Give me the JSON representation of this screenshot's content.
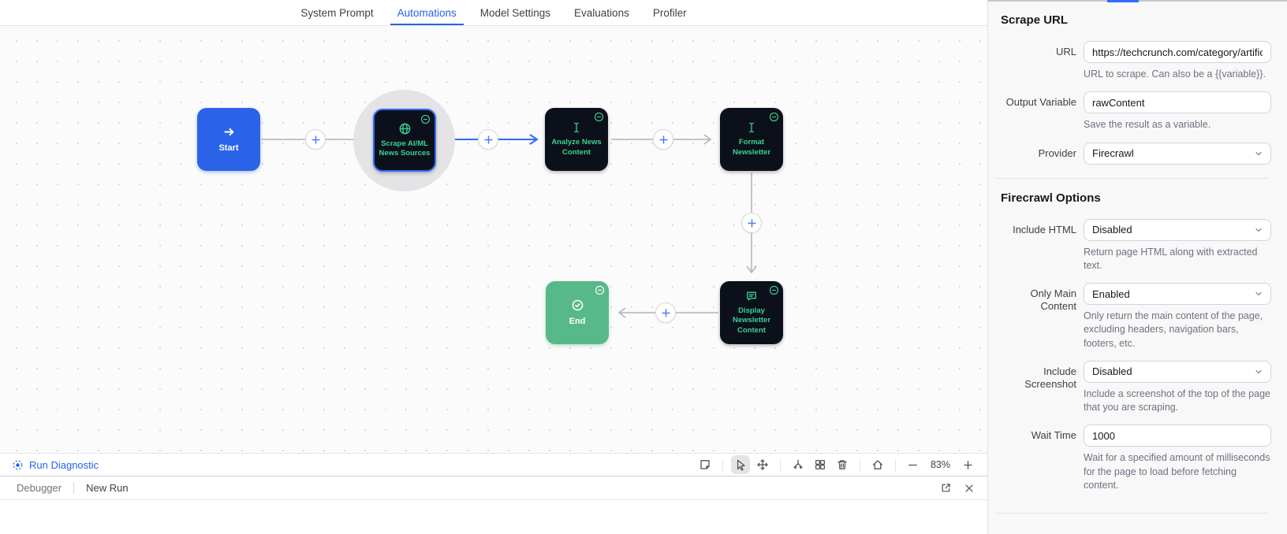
{
  "nav": {
    "tabs": [
      {
        "label": "System Prompt"
      },
      {
        "label": "Automations"
      },
      {
        "label": "Model Settings"
      },
      {
        "label": "Evaluations"
      },
      {
        "label": "Profiler"
      }
    ],
    "active_tab": "Automations"
  },
  "canvas": {
    "nodes": {
      "start": {
        "label": "Start"
      },
      "scrape": {
        "label": "Scrape AI/ML News Sources",
        "selected": true
      },
      "analyze": {
        "label": "Analyze News Content"
      },
      "format": {
        "label": "Format Newsletter"
      },
      "display": {
        "label": "Display Newsletter Content"
      },
      "end": {
        "label": "End"
      }
    },
    "run_diagnostic": "Run Diagnostic",
    "toolbar": {
      "zoom_level": "83%"
    }
  },
  "debugger": {
    "title": "Debugger",
    "run_tab": "New Run"
  },
  "inspector": {
    "heading": "Scrape URL",
    "url": {
      "label": "URL",
      "value": "https://techcrunch.com/category/artific",
      "help": "URL to scrape. Can also be a {{variable}}."
    },
    "output_variable": {
      "label": "Output Variable",
      "value": "rawContent",
      "help": "Save the result as a variable."
    },
    "provider": {
      "label": "Provider",
      "value": "Firecrawl"
    },
    "options_heading": "Firecrawl Options",
    "include_html": {
      "label": "Include HTML",
      "value": "Disabled",
      "help": "Return page HTML along with extracted text."
    },
    "only_main_content": {
      "label": "Only Main Content",
      "value": "Enabled",
      "help": "Only return the main content of the page, excluding headers, navigation bars, footers, etc."
    },
    "include_screenshot": {
      "label": "Include Screenshot",
      "value": "Disabled",
      "help": "Include a screenshot of the top of the page that you are scraping."
    },
    "wait_time": {
      "label": "Wait Time",
      "value": "1000",
      "help": "Wait for a specified amount of milliseconds for the page to load before fetching content."
    }
  },
  "colors": {
    "accent_blue": "#2563eb",
    "edge_blue": "#2e6bff",
    "edge_gray": "#b3b3b8",
    "node_dark": "#0b101b",
    "node_green_text": "#3cd391",
    "end_green": "#58b988",
    "start_blue": "#2b63e8"
  }
}
